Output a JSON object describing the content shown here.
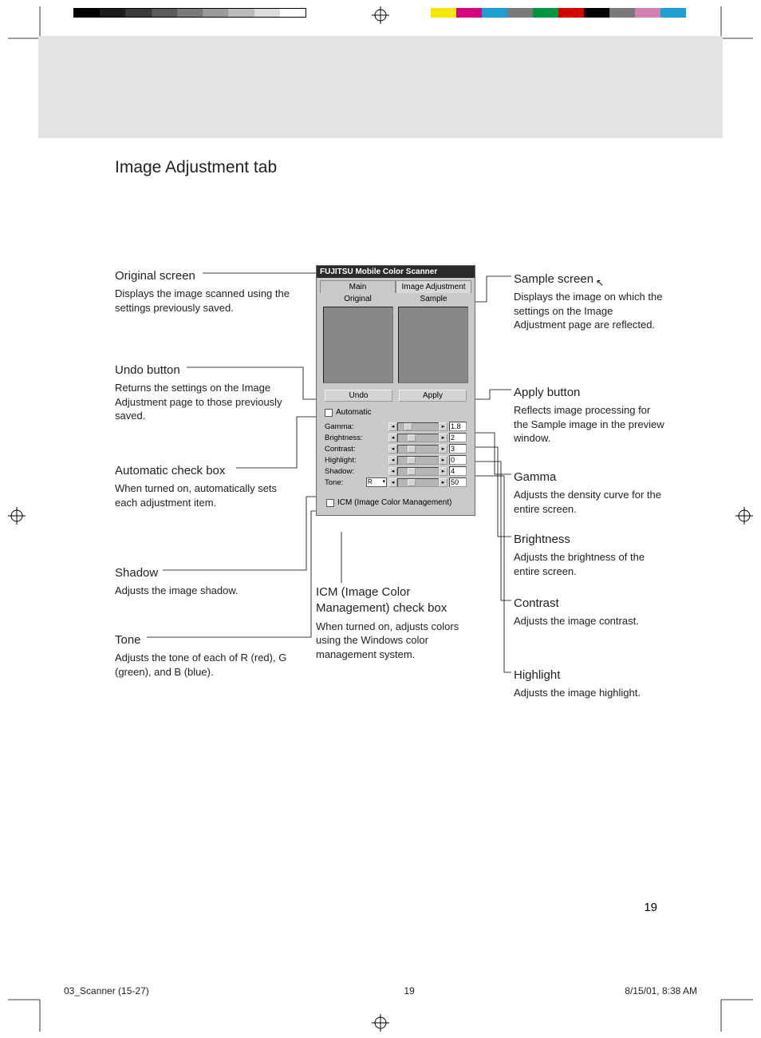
{
  "page_title": "Image Adjustment tab",
  "page_number": "19",
  "footer": {
    "file": "03_Scanner (15-27)",
    "page": "19",
    "stamp": "8/15/01, 8:38 AM"
  },
  "dialog": {
    "title": "FUJITSU Mobile Color Scanner",
    "tabs": {
      "main": "Main",
      "image_adjustment": "Image Adjustment"
    },
    "subhead": {
      "original": "Original",
      "sample": "Sample"
    },
    "buttons": {
      "undo": "Undo",
      "apply": "Apply"
    },
    "automatic_label": "Automatic",
    "icm_label": "ICM (Image Color Management)",
    "adjustments": {
      "gamma": {
        "label": "Gamma:",
        "value": "1.8"
      },
      "brightness": {
        "label": "Brightness:",
        "value": "2"
      },
      "contrast": {
        "label": "Contrast:",
        "value": "3"
      },
      "highlight": {
        "label": "Highlight:",
        "value": "0"
      },
      "shadow": {
        "label": "Shadow:",
        "value": "4"
      },
      "tone": {
        "label": "Tone:",
        "channel": "R",
        "value": "50"
      }
    }
  },
  "callouts": {
    "original": {
      "title": "Original screen",
      "body": "Displays the image scanned using the settings previously saved."
    },
    "undo": {
      "title": "Undo button",
      "body": "Returns the settings on the Image Adjustment page to those previously saved."
    },
    "automatic": {
      "title": "Automatic check box",
      "body": "When turned on, automatically sets each adjustment item."
    },
    "shadow": {
      "title": "Shadow",
      "body": "Adjusts the image shadow."
    },
    "tone": {
      "title": "Tone",
      "body": "Adjusts the tone of each of R (red), G (green), and B (blue)."
    },
    "icm": {
      "title": "ICM (Image Color Management) check box",
      "body": "When turned on, adjusts colors using the Windows color management system."
    },
    "sample": {
      "title": "Sample screen",
      "body": "Displays the image on which the settings on the Image Adjustment page are reflected."
    },
    "apply": {
      "title": "Apply button",
      "body": "Reflects image processing for the Sample image in the preview window."
    },
    "gamma": {
      "title": "Gamma",
      "body": "Adjusts the density curve for the entire screen."
    },
    "brightness": {
      "title": "Brightness",
      "body": "Adjusts the brightness of the entire screen."
    },
    "contrast": {
      "title": "Contrast",
      "body": "Adjusts the image contrast."
    },
    "highlight": {
      "title": "Highlight",
      "body": "Adjusts the image highlight."
    }
  },
  "glyphs": {
    "left": "◂",
    "right": "▸",
    "cursor": "↖"
  },
  "colorbars": {
    "left": [
      "#000",
      "#1c1c1c",
      "#3a3a3a",
      "#5a5a5a",
      "#7a7a7a",
      "#9a9a9a",
      "#bababa",
      "#dcdcdc",
      "#fff"
    ],
    "right": [
      "#f6e600",
      "#d4007f",
      "#1ea0d2",
      "#7a7a7a",
      "#009640",
      "#d20000",
      "#000",
      "#7a7a7a",
      "#d37fb0",
      "#1ea0d2"
    ]
  }
}
